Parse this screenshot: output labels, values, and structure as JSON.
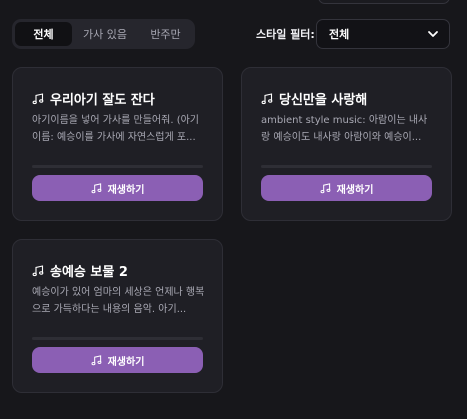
{
  "tabs": [
    {
      "label": "전체",
      "active": true
    },
    {
      "label": "가사 있음",
      "active": false
    },
    {
      "label": "반주만",
      "active": false
    }
  ],
  "filter": {
    "label": "스타일 필터:",
    "selected": "전체"
  },
  "cards": [
    {
      "title": "우리아기 잘도 잔다",
      "description": "아기이름을 넣어 가사를 만들어줘. (아기이름: 예승이를 가사에 자연스럽게 포...",
      "play_label": "재생하기"
    },
    {
      "title": "당신만을 사랑해",
      "description": "ambient style music: 아람이는 내사랑 예승이도 내사랑 아람이와 예승이...",
      "play_label": "재생하기"
    },
    {
      "title": "송예승 보물 2",
      "description": "예승이가 있어 엄마의 세상은 언제나 행복으로 가득하다는 내용의 음악. 아기...",
      "play_label": "재생하기"
    }
  ],
  "icons": {
    "music": "music-note-icon",
    "dropdown": "chevron-down-icon"
  },
  "colors": {
    "background": "#17171b",
    "card": "#1f1f25",
    "accent": "#8b5fb4"
  }
}
